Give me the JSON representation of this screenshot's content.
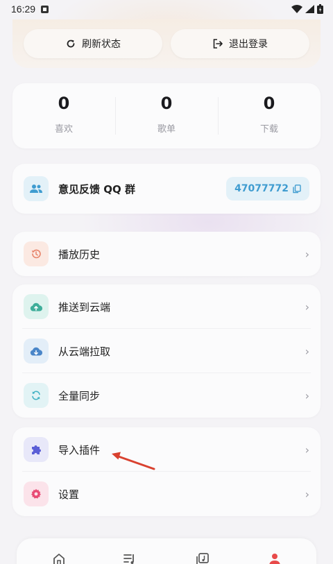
{
  "status": {
    "time": "16:29"
  },
  "actions": {
    "refresh_label": "刷新状态",
    "logout_label": "退出登录"
  },
  "stats": [
    {
      "value": "0",
      "label": "喜欢"
    },
    {
      "value": "0",
      "label": "歌单"
    },
    {
      "value": "0",
      "label": "下载"
    }
  ],
  "feedback": {
    "title": "意见反馈 QQ 群",
    "group_number": "47077772"
  },
  "menu": {
    "history": "播放历史",
    "push_cloud": "推送到云端",
    "pull_cloud": "从云端拉取",
    "full_sync": "全量同步",
    "import_plugin": "导入插件",
    "settings": "设置"
  },
  "colors": {
    "accent_blue": "#3f9cd0",
    "history_icon": "#e7836a",
    "cloud_icon": "#3fae9a",
    "plugin_icon": "#5b5fd6",
    "settings_icon": "#e84a74",
    "annotation_arrow": "#d9412f"
  }
}
